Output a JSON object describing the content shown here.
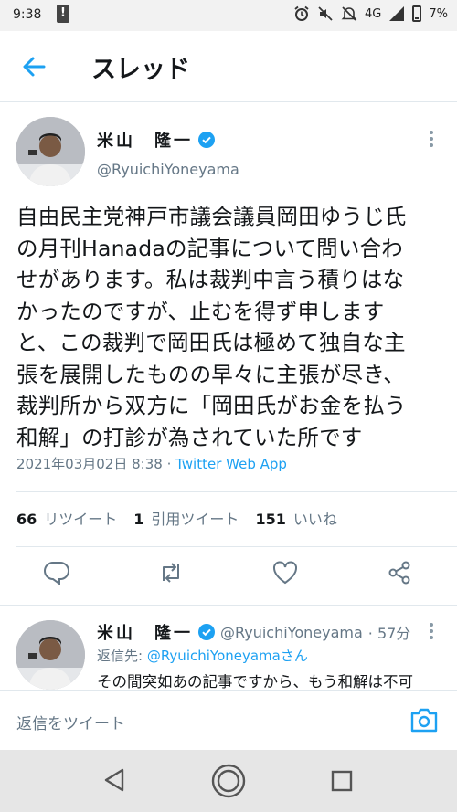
{
  "status_bar": {
    "time": "9:38",
    "network": "4G",
    "battery": "7%",
    "icons": [
      "alert-icon",
      "alarm-icon",
      "mute-icon",
      "notifications-off-icon",
      "signal-icon",
      "battery-icon"
    ]
  },
  "header": {
    "title": "スレッド",
    "back_icon": "arrow-left-icon"
  },
  "main_tweet": {
    "author_name": "米山　隆一",
    "handle": "@RyuichiYoneyama",
    "text_lines": [
      "自由民主党神戸市議会議員岡田ゆうじ氏",
      "の月刊Hanadaの記事について問い合わ",
      "せがあります。私は裁判中言う積りはな",
      "かったのですが、止むを得ず申します",
      "と、この裁判で岡田氏は極めて独自な主",
      "張を展開したものの早々に主張が尽き、",
      "裁判所から双方に「岡田氏がお金を払う",
      "和解」の打診が為されていた所です"
    ],
    "timestamp": "2021年03月02日 8:38 · ",
    "via": "Twitter Web App",
    "retweets_count": "66",
    "retweets_label": "リツイート",
    "quotes_count": "1",
    "quotes_label": "引用ツイート",
    "likes_count": "151",
    "likes_label": "いいね"
  },
  "reply_tweet": {
    "author_name": "米山　隆一",
    "handle": "@RyuichiYoneyama",
    "time_ago": "· 57分",
    "reply_to_prefix": "返信先: ",
    "reply_to_handle": "@RyuichiYoneyama",
    "reply_to_suffix": "さん",
    "text": "その間突如あの記事ですから、もう和解は不可"
  },
  "composer": {
    "placeholder": "返信をツイート"
  },
  "colors": {
    "accent": "#1da1f2",
    "secondary_text": "#657786",
    "divider": "#e1e8ed"
  }
}
